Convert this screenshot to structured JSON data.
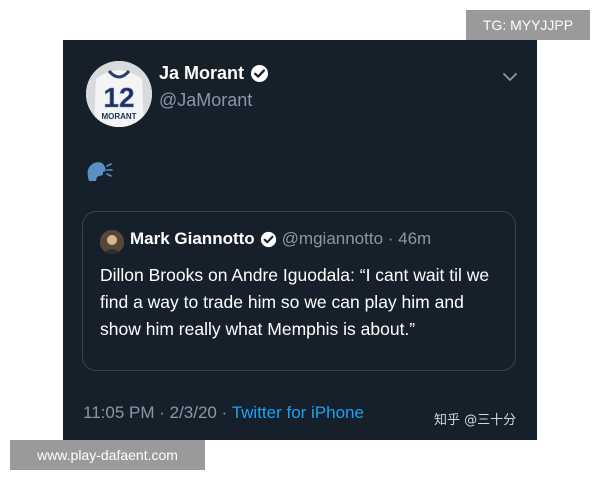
{
  "watermarks": {
    "top_right": "TG: MYYJJPP",
    "bottom_left": "www.play-dafaent.com",
    "credit": "知乎 @三十分"
  },
  "tweet": {
    "display_name": "Ja Morant",
    "handle": "@JaMorant",
    "avatar_jersey_number": "12",
    "avatar_jersey_name": "MORANT",
    "body_icon": "speaking-head-icon",
    "timestamp": "11:05 PM · 2/3/20 · ",
    "source": "Twitter for iPhone"
  },
  "quoted_tweet": {
    "display_name": "Mark Giannotto",
    "handle_time": "@mgiannotto · 46m",
    "text": "Dillon Brooks on Andre Iguodala: “I cant wait til we find a way to trade him so we can play him and show him really what Memphis is about.”"
  },
  "colors": {
    "background": "#15202b",
    "secondary_text": "#8899a6",
    "link": "#1da1f2",
    "border": "#38444d"
  }
}
